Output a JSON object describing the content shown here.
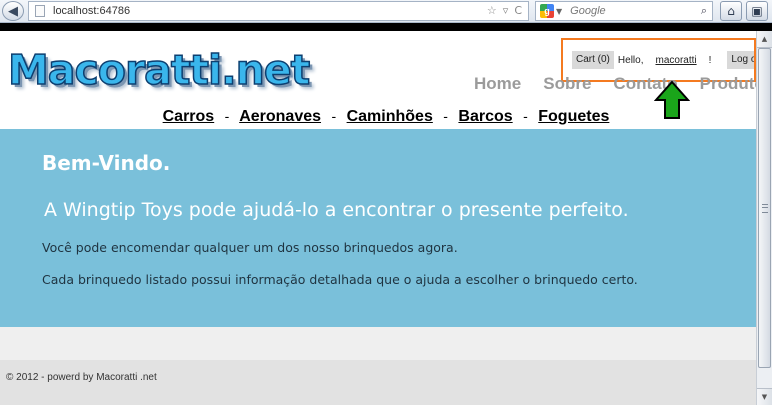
{
  "browser": {
    "url": "localhost:64786",
    "search_placeholder": "Google",
    "back_glyph": "◀",
    "star_glyph": "☆",
    "dropdown_glyph": "▿",
    "refresh_glyph": "C",
    "search_glyph": "⌕",
    "home_glyph": "⌂",
    "extra_glyph": "▣"
  },
  "header": {
    "logo_text": "Macoratti.net",
    "cart_label": "Cart (0)",
    "hello_label": "Hello,",
    "username": "macoratti",
    "exclamation": "!",
    "logoff_label": "Log off",
    "menu": [
      "Home",
      "Sobre",
      "Contato",
      "Produtos"
    ],
    "highlight_color": "#f47a20",
    "arrow_color": "#1aa51a"
  },
  "categories": [
    "Carros",
    "Aeronaves",
    "Caminhões",
    "Barcos",
    "Foguetes"
  ],
  "category_separator": "-",
  "main": {
    "welcome": "Bem-Vindo.",
    "tagline": "A Wingtip Toys pode ajudá-lo a encontrar o presente perfeito.",
    "info1": "Você pode encomendar qualquer um dos nosso brinquedos agora.",
    "info2": "Cada brinquedo listado possui informação detalhada que o ajuda a escolher o brinquedo certo.",
    "background": "#7ac0da"
  },
  "footer": {
    "text": "© 2012 - powerd by Macoratti .net"
  }
}
